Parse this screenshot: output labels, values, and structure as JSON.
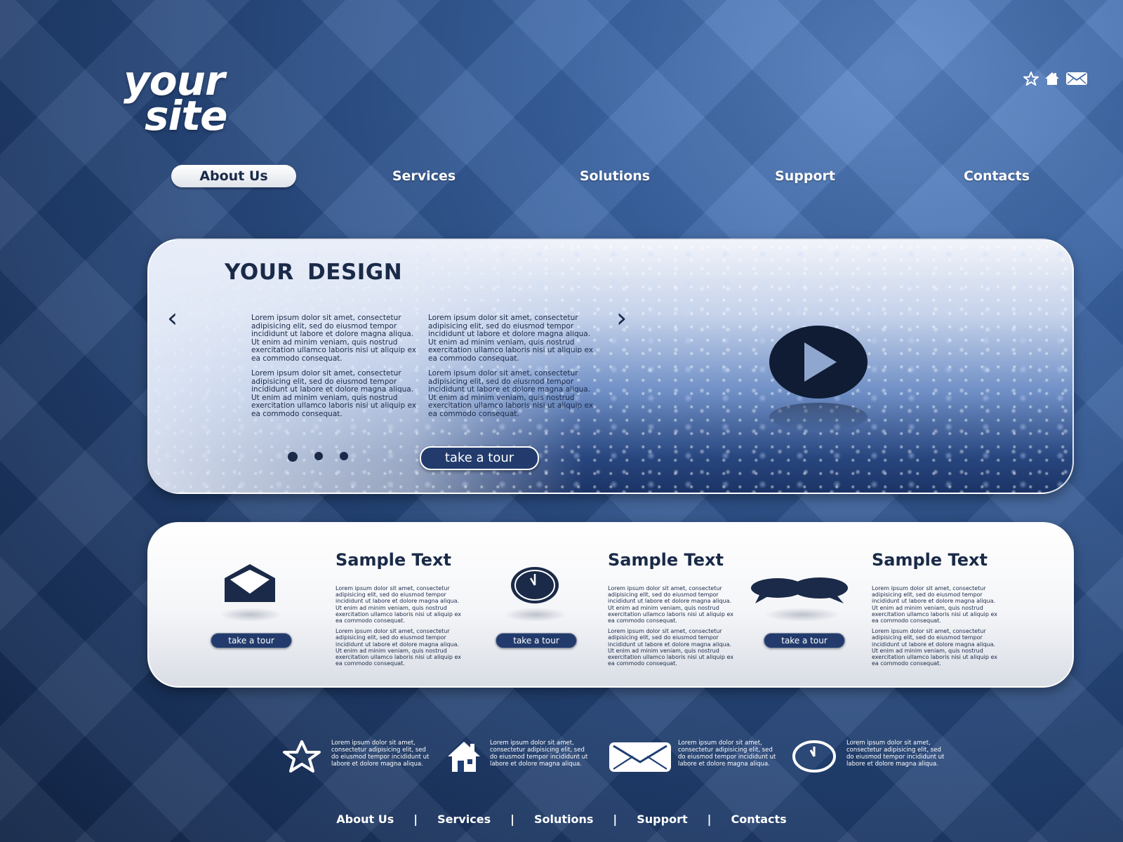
{
  "logo": {
    "line1": "your",
    "line2": "site"
  },
  "top_icons": [
    "star-icon",
    "home-icon",
    "mail-icon"
  ],
  "nav": {
    "items": [
      {
        "label": "About Us",
        "active": true
      },
      {
        "label": "Services",
        "active": false
      },
      {
        "label": "Solutions",
        "active": false
      },
      {
        "label": "Support",
        "active": false
      },
      {
        "label": "Contacts",
        "active": false
      }
    ]
  },
  "hero": {
    "title": "YOUR DESIGN",
    "col1": {
      "p1": "Lorem ipsum dolor sit amet, consectetur adipisicing elit, sed do eiusmod tempor incididunt ut labore et dolore magna aliqua. Ut enim ad minim veniam, quis nostrud exercitation ullamco laboris nisi ut aliquip ex ea commodo consequat.",
      "p2": "Lorem ipsum dolor sit amet, consectetur adipisicing elit, sed do eiusmod tempor incididunt ut labore et dolore magna aliqua. Ut enim ad minim veniam, quis nostrud exercitation ullamco laboris nisi ut aliquip ex ea commodo consequat."
    },
    "col2": {
      "p1": "Lorem ipsum dolor sit amet, consectetur adipisicing elit, sed do eiusmod tempor incididunt ut labore et dolore magna aliqua. Ut enim ad minim veniam, quis nostrud exercitation ullamco laboris nisi ut aliquip ex ea commodo consequat.",
      "p2": "Lorem ipsum dolor sit amet, consectetur adipisicing elit, sed do eiusmod tempor incididunt ut labore et dolore magna aliqua. Ut enim ad minim veniam, quis nostrud exercitation ullamco laboris nisi ut aliquip ex ea commodo consequat."
    },
    "prev_arrow": "‹",
    "next_arrow": "›",
    "button_label": "take a tour",
    "slides_count": 3,
    "active_slide": 1,
    "media_icon": "play-icon"
  },
  "features": [
    {
      "icon": "envelope-icon",
      "title": "Sample Text",
      "p1": "Lorem ipsum dolor sit amet, consectetur adipisicing elit, sed do eiusmod tempor incididunt ut labore et dolore magna aliqua. Ut enim ad minim veniam, quis nostrud exercitation ullamco laboris nisi ut aliquip ex ea commodo consequat.",
      "p2": "Lorem ipsum dolor sit amet, consectetur adipisicing elit, sed do eiusmod tempor incididunt ut labore et dolore magna aliqua. Ut enim ad minim veniam, quis nostrud exercitation ullamco laboris nisi ut aliquip ex ea commodo consequat.",
      "button_label": "take a tour"
    },
    {
      "icon": "clock-icon",
      "title": "Sample Text",
      "p1": "Lorem ipsum dolor sit amet, consectetur adipisicing elit, sed do eiusmod tempor incididunt ut labore et dolore magna aliqua. Ut enim ad minim veniam, quis nostrud exercitation ullamco laboris nisi ut aliquip ex ea commodo consequat.",
      "p2": "Lorem ipsum dolor sit amet, consectetur adipisicing elit, sed do eiusmod tempor incididunt ut labore et dolore magna aliqua. Ut enim ad minim veniam, quis nostrud exercitation ullamco laboris nisi ut aliquip ex ea commodo consequat.",
      "button_label": "take a tour"
    },
    {
      "icon": "chat-bubbles-icon",
      "title": "Sample Text",
      "p1": "Lorem ipsum dolor sit amet, consectetur adipisicing elit, sed do eiusmod tempor incididunt ut labore et dolore magna aliqua. Ut enim ad minim veniam, quis nostrud exercitation ullamco laboris nisi ut aliquip ex ea commodo consequat.",
      "p2": "Lorem ipsum dolor sit amet, consectetur adipisicing elit, sed do eiusmod tempor incididunt ut labore et dolore magna aliqua. Ut enim ad minim veniam, quis nostrud exercitation ullamco laboris nisi ut aliquip ex ea commodo consequat.",
      "button_label": "take a tour"
    }
  ],
  "info_items": [
    {
      "icon": "star-icon",
      "text": "Lorem ipsum dolor sit amet, consectetur adipisicing elit, sed do eiusmod tempor incididunt ut labore et dolore magna aliqua."
    },
    {
      "icon": "home-icon",
      "text": "Lorem ipsum dolor sit amet, consectetur adipisicing elit, sed do eiusmod tempor incididunt ut labore et dolore magna aliqua."
    },
    {
      "icon": "mail-icon",
      "text": "Lorem ipsum dolor sit amet, consectetur adipisicing elit, sed do eiusmod tempor incididunt ut labore et dolore magna aliqua."
    },
    {
      "icon": "clock-icon",
      "text": "Lorem ipsum dolor sit amet, consectetur adipisicing elit, sed do eiusmod tempor incididunt ut labore et dolore magna aliqua."
    }
  ],
  "footer": {
    "links": [
      "About Us",
      "Services",
      "Solutions",
      "Support",
      "Contacts"
    ],
    "separator": "|"
  },
  "colors": {
    "brand_dark": "#1a2a48",
    "background": "#1f3e73",
    "button": "#223b6c",
    "text_light": "#ffffff"
  }
}
